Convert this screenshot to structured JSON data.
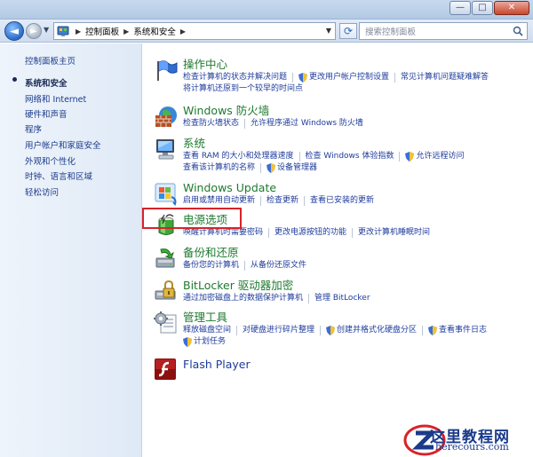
{
  "window": {
    "caption": {
      "minimize": "—",
      "maximize": "□",
      "close": "✕"
    }
  },
  "nav": {
    "back": "◄",
    "forward": "►",
    "breadcrumb": [
      "控制面板",
      "系统和安全"
    ],
    "search_placeholder": "搜索控制面板"
  },
  "sidebar": {
    "home": "控制面板主页",
    "items": [
      {
        "label": "系统和安全",
        "current": true
      },
      {
        "label": "网络和 Internet"
      },
      {
        "label": "硬件和声音"
      },
      {
        "label": "程序"
      },
      {
        "label": "用户帐户和家庭安全"
      },
      {
        "label": "外观和个性化"
      },
      {
        "label": "时钟、语言和区域"
      },
      {
        "label": "轻松访问"
      }
    ]
  },
  "categories": [
    {
      "icon": "flag-icon",
      "title": "操作中心",
      "lines": [
        [
          {
            "t": "检查计算机的状态并解决问题"
          },
          {
            "t": "更改用户帐户控制设置",
            "shield": true
          },
          {
            "t": "常见计算机问题疑难解答"
          }
        ],
        [
          {
            "t": "将计算机还原到一个较早的时间点"
          }
        ]
      ]
    },
    {
      "icon": "firewall-icon",
      "title": "Windows 防火墙",
      "lines": [
        [
          {
            "t": "检查防火墙状态"
          },
          {
            "t": "允许程序通过 Windows 防火墙"
          }
        ]
      ]
    },
    {
      "icon": "computer-icon",
      "title": "系统",
      "lines": [
        [
          {
            "t": "查看 RAM 的大小和处理器速度"
          },
          {
            "t": "检查 Windows 体验指数"
          },
          {
            "t": "允许远程访问",
            "shield": true
          }
        ],
        [
          {
            "t": "查看该计算机的名称"
          },
          {
            "t": "设备管理器",
            "shield": true
          }
        ]
      ]
    },
    {
      "icon": "windows-update-icon",
      "title": "Windows Update",
      "lines": [
        [
          {
            "t": "启用或禁用自动更新"
          },
          {
            "t": "检查更新"
          },
          {
            "t": "查看已安装的更新"
          }
        ]
      ]
    },
    {
      "icon": "power-options-icon",
      "title": "电源选项",
      "lines": [
        [
          {
            "t": "唤醒计算机时需要密码"
          },
          {
            "t": "更改电源按钮的功能"
          },
          {
            "t": "更改计算机睡眠时间"
          }
        ]
      ]
    },
    {
      "icon": "backup-icon",
      "title": "备份和还原",
      "lines": [
        [
          {
            "t": "备份您的计算机"
          },
          {
            "t": "从备份还原文件"
          }
        ]
      ]
    },
    {
      "icon": "bitlocker-icon",
      "title": "BitLocker 驱动器加密",
      "lines": [
        [
          {
            "t": "通过加密磁盘上的数据保护计算机"
          },
          {
            "t": "管理 BitLocker"
          }
        ]
      ]
    },
    {
      "icon": "admin-tools-icon",
      "title": "管理工具",
      "lines": [
        [
          {
            "t": "释放磁盘空间"
          },
          {
            "t": "对硬盘进行碎片整理"
          },
          {
            "t": "创建并格式化硬盘分区",
            "shield": true
          },
          {
            "t": "查看事件日志",
            "shield": true
          }
        ],
        [
          {
            "t": "计划任务",
            "shield": true
          }
        ]
      ]
    },
    {
      "icon": "flash-player-icon",
      "title": "Flash Player",
      "lines": []
    }
  ],
  "highlighted_category": "电源选项",
  "watermark": {
    "text": "这里教程网",
    "url": "herecours.com"
  }
}
